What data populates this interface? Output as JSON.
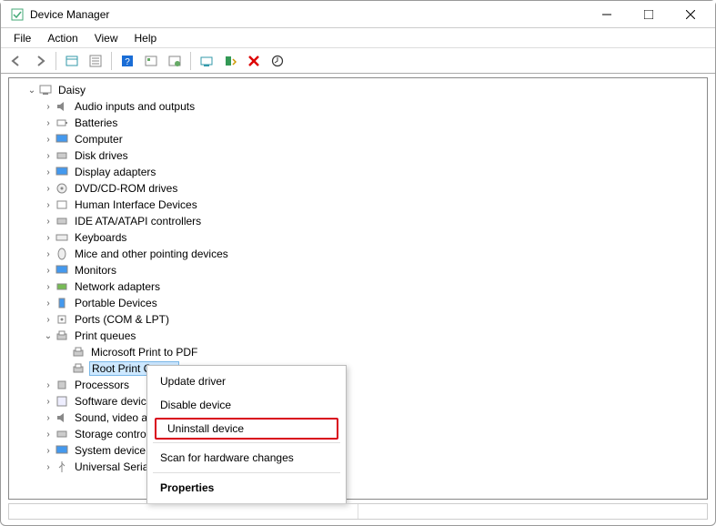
{
  "window": {
    "title": "Device Manager"
  },
  "menu": {
    "file": "File",
    "action": "Action",
    "view": "View",
    "help": "Help"
  },
  "tree": {
    "root": "Daisy",
    "items": [
      "Audio inputs and outputs",
      "Batteries",
      "Computer",
      "Disk drives",
      "Display adapters",
      "DVD/CD-ROM drives",
      "Human Interface Devices",
      "IDE ATA/ATAPI controllers",
      "Keyboards",
      "Mice and other pointing devices",
      "Monitors",
      "Network adapters",
      "Portable Devices",
      "Ports (COM & LPT)"
    ],
    "print_queues": {
      "label": "Print queues",
      "children": [
        "Microsoft Print to PDF",
        "Root Print Queue"
      ]
    },
    "after": [
      "Processors",
      "Software devic",
      "Sound, video a",
      "Storage contro",
      "System device",
      "Universal Seria"
    ]
  },
  "context": {
    "update": "Update driver",
    "disable": "Disable device",
    "uninstall": "Uninstall device",
    "scan": "Scan for hardware changes",
    "properties": "Properties"
  }
}
